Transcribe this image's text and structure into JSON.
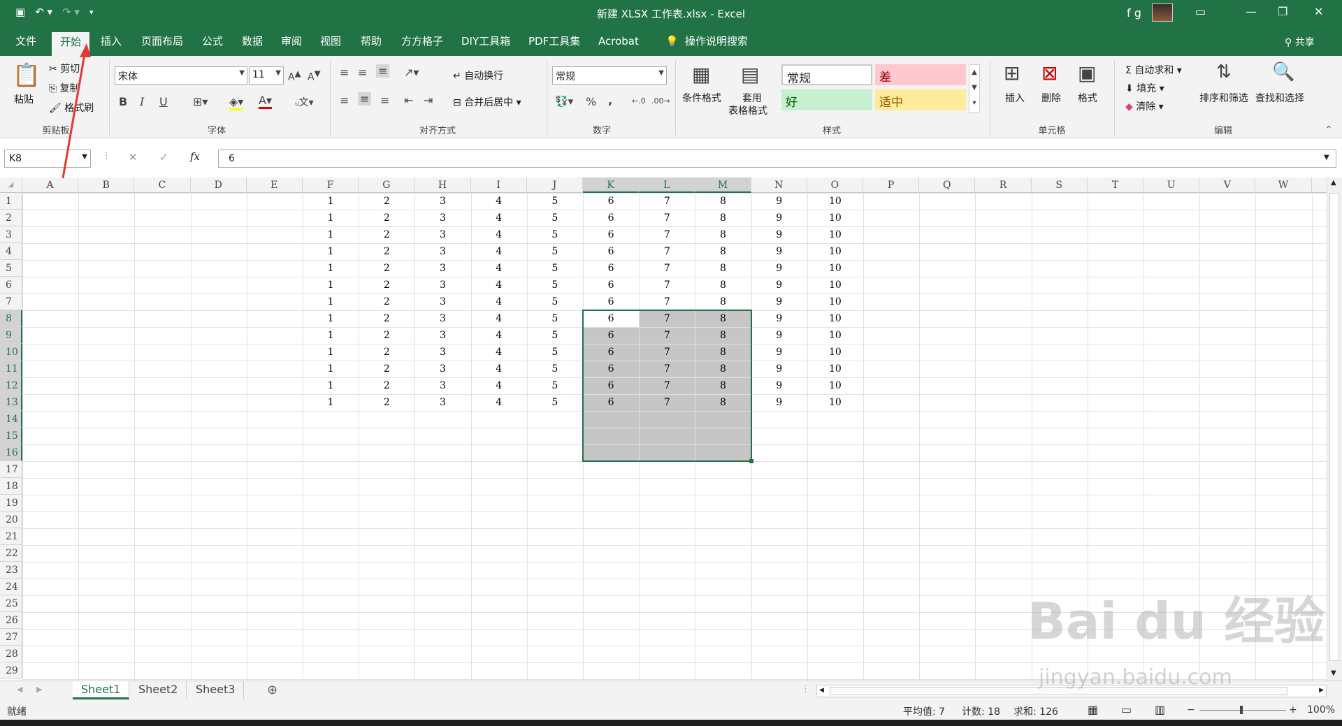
{
  "window": {
    "title": "新建 XLSX 工作表.xlsx  -  Excel",
    "user": "f g",
    "qat_icons": [
      "save-icon",
      "undo-icon",
      "redo-icon",
      "customize-icon"
    ]
  },
  "tabs": [
    "文件",
    "开始",
    "插入",
    "页面布局",
    "公式",
    "数据",
    "审阅",
    "视图",
    "帮助",
    "方方格子",
    "DIY工具箱",
    "PDF工具集",
    "Acrobat",
    "操作说明搜索"
  ],
  "active_tab": "开始",
  "share_label": "共享",
  "ribbon": {
    "clipboard": {
      "paste": "粘贴",
      "cut": "剪切",
      "copy": "复制",
      "format_painter": "格式刷",
      "label": "剪贴板"
    },
    "font": {
      "name": "宋体",
      "size": "11",
      "label": "字体",
      "bold": "B",
      "italic": "I",
      "underline": "U"
    },
    "alignment": {
      "wrap": "自动换行",
      "merge": "合并后居中",
      "label": "对齐方式"
    },
    "number": {
      "format": "常规",
      "label": "数字",
      "percent": "%",
      "comma": ","
    },
    "styles": {
      "conditional": "条件格式",
      "table_line1": "套用",
      "table_line2": "表格格式",
      "normal": "常规",
      "bad": "差",
      "good": "好",
      "neutral": "适中",
      "label": "样式"
    },
    "cells": {
      "insert": "插入",
      "delete": "删除",
      "format": "格式",
      "label": "单元格"
    },
    "editing": {
      "autosum": "自动求和",
      "fill": "填充",
      "clear": "清除",
      "sort": "排序和筛选",
      "find": "查找和选择",
      "label": "编辑"
    }
  },
  "formula_bar": {
    "name_box": "K8",
    "value": "6",
    "fx": "fx"
  },
  "columns": [
    "A",
    "B",
    "C",
    "D",
    "E",
    "F",
    "G",
    "H",
    "I",
    "J",
    "K",
    "L",
    "M",
    "N",
    "O",
    "P",
    "Q",
    "R",
    "S",
    "T",
    "U",
    "V",
    "W"
  ],
  "selected_columns": [
    "K",
    "L",
    "M"
  ],
  "rows": [
    "1",
    "2",
    "3",
    "4",
    "5",
    "6",
    "7",
    "8",
    "9",
    "10",
    "11",
    "12",
    "13",
    "14",
    "15",
    "16",
    "17",
    "18",
    "19",
    "20",
    "21",
    "22",
    "23",
    "24",
    "25",
    "26",
    "27",
    "28",
    "29"
  ],
  "selected_rows": [
    "8",
    "9",
    "10",
    "11",
    "12",
    "13",
    "14",
    "15",
    "16"
  ],
  "data_row_values": [
    "1",
    "2",
    "3",
    "4",
    "5",
    "6",
    "7",
    "8",
    "9",
    "10"
  ],
  "data_row_count": 13,
  "sheets": [
    "Sheet1",
    "Sheet2",
    "Sheet3"
  ],
  "active_sheet": "Sheet1",
  "status": {
    "ready": "就绪",
    "average": "平均值: 7",
    "count": "计数: 18",
    "sum": "求和: 126",
    "zoom": "100%"
  },
  "watermark": {
    "main": "Bai du 经验",
    "sub": "jingyan.baidu.com"
  }
}
